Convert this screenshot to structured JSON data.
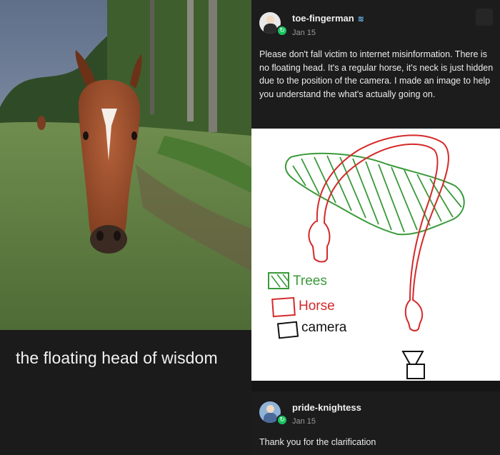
{
  "left_panel": {
    "caption": "the floating head of wisdom"
  },
  "post1": {
    "username": "toe-fingerman",
    "date": "Jan 15",
    "text": "Please don't fall victim to internet misinformation. There is no floating head. It's a regular horse, it's neck is just hidden due to the position of the camera. I made an image to help you understand the what's actually going on."
  },
  "drawing": {
    "legend": {
      "trees": "Trees",
      "horse": "Horse",
      "camera": "camera"
    },
    "colors": {
      "trees": "#3a9a3a",
      "horse": "#d42a2a",
      "camera": "#111111"
    }
  },
  "post2": {
    "username": "pride-knightess",
    "date": "Jan 15",
    "text": "Thank you for the clarification"
  }
}
